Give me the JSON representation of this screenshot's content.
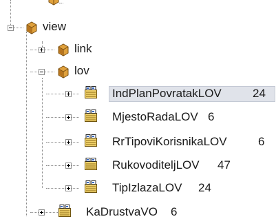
{
  "tree": {
    "nodes": [
      {
        "key": "top_partial",
        "label": "",
        "count": ""
      },
      {
        "key": "view",
        "label": "view",
        "count": ""
      },
      {
        "key": "link",
        "label": "link",
        "count": ""
      },
      {
        "key": "lov",
        "label": "lov",
        "count": ""
      },
      {
        "key": "ind_plan",
        "label": "IndPlanPovratakLOV",
        "count": "24",
        "selected": true
      },
      {
        "key": "mjesto_rada",
        "label": "MjestoRadaLOV",
        "count": "6"
      },
      {
        "key": "rr_tipovi",
        "label": "RrTipoviKorisnikaLOV",
        "count": "6"
      },
      {
        "key": "rukovoditelj",
        "label": "RukovoditeljLOV",
        "count": "47"
      },
      {
        "key": "tip_izlaza",
        "label": "TipIzlazaLOV",
        "count": "24"
      },
      {
        "key": "ka_drustva",
        "label": "KaDrustvaVO",
        "count": "6"
      }
    ]
  },
  "colors": {
    "selection": "#e0e3ea",
    "package": "#c98a2e",
    "component": "#d4a531"
  },
  "icons": {
    "package": "package-icon",
    "component": "view-object-icon",
    "expand": "plus-icon",
    "collapse": "minus-icon"
  }
}
